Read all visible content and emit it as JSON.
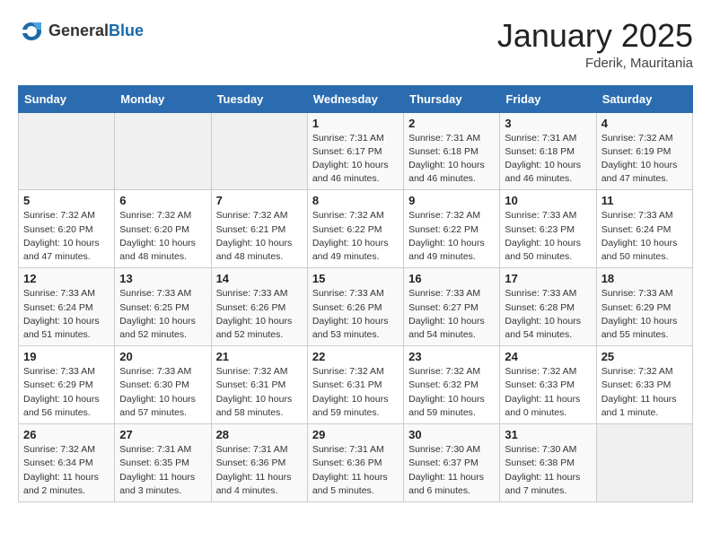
{
  "header": {
    "logo_general": "General",
    "logo_blue": "Blue",
    "month_year": "January 2025",
    "location": "Fderik, Mauritania"
  },
  "days_of_week": [
    "Sunday",
    "Monday",
    "Tuesday",
    "Wednesday",
    "Thursday",
    "Friday",
    "Saturday"
  ],
  "weeks": [
    [
      {
        "num": "",
        "info": ""
      },
      {
        "num": "",
        "info": ""
      },
      {
        "num": "",
        "info": ""
      },
      {
        "num": "1",
        "info": "Sunrise: 7:31 AM\nSunset: 6:17 PM\nDaylight: 10 hours\nand 46 minutes."
      },
      {
        "num": "2",
        "info": "Sunrise: 7:31 AM\nSunset: 6:18 PM\nDaylight: 10 hours\nand 46 minutes."
      },
      {
        "num": "3",
        "info": "Sunrise: 7:31 AM\nSunset: 6:18 PM\nDaylight: 10 hours\nand 46 minutes."
      },
      {
        "num": "4",
        "info": "Sunrise: 7:32 AM\nSunset: 6:19 PM\nDaylight: 10 hours\nand 47 minutes."
      }
    ],
    [
      {
        "num": "5",
        "info": "Sunrise: 7:32 AM\nSunset: 6:20 PM\nDaylight: 10 hours\nand 47 minutes."
      },
      {
        "num": "6",
        "info": "Sunrise: 7:32 AM\nSunset: 6:20 PM\nDaylight: 10 hours\nand 48 minutes."
      },
      {
        "num": "7",
        "info": "Sunrise: 7:32 AM\nSunset: 6:21 PM\nDaylight: 10 hours\nand 48 minutes."
      },
      {
        "num": "8",
        "info": "Sunrise: 7:32 AM\nSunset: 6:22 PM\nDaylight: 10 hours\nand 49 minutes."
      },
      {
        "num": "9",
        "info": "Sunrise: 7:32 AM\nSunset: 6:22 PM\nDaylight: 10 hours\nand 49 minutes."
      },
      {
        "num": "10",
        "info": "Sunrise: 7:33 AM\nSunset: 6:23 PM\nDaylight: 10 hours\nand 50 minutes."
      },
      {
        "num": "11",
        "info": "Sunrise: 7:33 AM\nSunset: 6:24 PM\nDaylight: 10 hours\nand 50 minutes."
      }
    ],
    [
      {
        "num": "12",
        "info": "Sunrise: 7:33 AM\nSunset: 6:24 PM\nDaylight: 10 hours\nand 51 minutes."
      },
      {
        "num": "13",
        "info": "Sunrise: 7:33 AM\nSunset: 6:25 PM\nDaylight: 10 hours\nand 52 minutes."
      },
      {
        "num": "14",
        "info": "Sunrise: 7:33 AM\nSunset: 6:26 PM\nDaylight: 10 hours\nand 52 minutes."
      },
      {
        "num": "15",
        "info": "Sunrise: 7:33 AM\nSunset: 6:26 PM\nDaylight: 10 hours\nand 53 minutes."
      },
      {
        "num": "16",
        "info": "Sunrise: 7:33 AM\nSunset: 6:27 PM\nDaylight: 10 hours\nand 54 minutes."
      },
      {
        "num": "17",
        "info": "Sunrise: 7:33 AM\nSunset: 6:28 PM\nDaylight: 10 hours\nand 54 minutes."
      },
      {
        "num": "18",
        "info": "Sunrise: 7:33 AM\nSunset: 6:29 PM\nDaylight: 10 hours\nand 55 minutes."
      }
    ],
    [
      {
        "num": "19",
        "info": "Sunrise: 7:33 AM\nSunset: 6:29 PM\nDaylight: 10 hours\nand 56 minutes."
      },
      {
        "num": "20",
        "info": "Sunrise: 7:33 AM\nSunset: 6:30 PM\nDaylight: 10 hours\nand 57 minutes."
      },
      {
        "num": "21",
        "info": "Sunrise: 7:32 AM\nSunset: 6:31 PM\nDaylight: 10 hours\nand 58 minutes."
      },
      {
        "num": "22",
        "info": "Sunrise: 7:32 AM\nSunset: 6:31 PM\nDaylight: 10 hours\nand 59 minutes."
      },
      {
        "num": "23",
        "info": "Sunrise: 7:32 AM\nSunset: 6:32 PM\nDaylight: 10 hours\nand 59 minutes."
      },
      {
        "num": "24",
        "info": "Sunrise: 7:32 AM\nSunset: 6:33 PM\nDaylight: 11 hours\nand 0 minutes."
      },
      {
        "num": "25",
        "info": "Sunrise: 7:32 AM\nSunset: 6:33 PM\nDaylight: 11 hours\nand 1 minute."
      }
    ],
    [
      {
        "num": "26",
        "info": "Sunrise: 7:32 AM\nSunset: 6:34 PM\nDaylight: 11 hours\nand 2 minutes."
      },
      {
        "num": "27",
        "info": "Sunrise: 7:31 AM\nSunset: 6:35 PM\nDaylight: 11 hours\nand 3 minutes."
      },
      {
        "num": "28",
        "info": "Sunrise: 7:31 AM\nSunset: 6:36 PM\nDaylight: 11 hours\nand 4 minutes."
      },
      {
        "num": "29",
        "info": "Sunrise: 7:31 AM\nSunset: 6:36 PM\nDaylight: 11 hours\nand 5 minutes."
      },
      {
        "num": "30",
        "info": "Sunrise: 7:30 AM\nSunset: 6:37 PM\nDaylight: 11 hours\nand 6 minutes."
      },
      {
        "num": "31",
        "info": "Sunrise: 7:30 AM\nSunset: 6:38 PM\nDaylight: 11 hours\nand 7 minutes."
      },
      {
        "num": "",
        "info": ""
      }
    ]
  ]
}
